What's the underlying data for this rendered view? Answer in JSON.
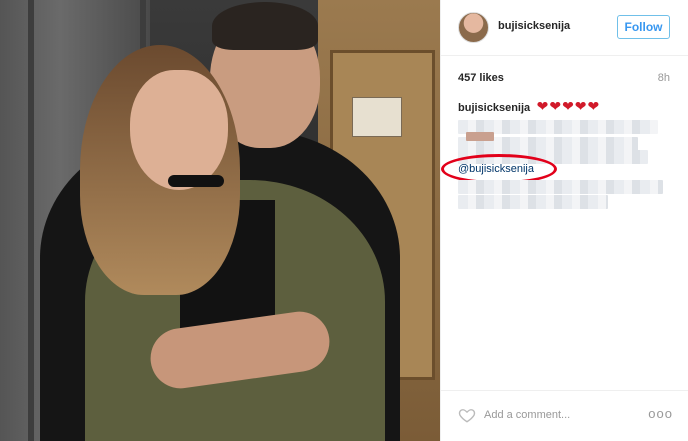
{
  "post": {
    "username": "bujisicksenija",
    "follow_label": "Follow",
    "likes": "457 likes",
    "time_ago": "8h",
    "caption_user": "bujisicksenija",
    "caption_emoji": "❤❤❤❤❤",
    "mention": "@bujisicksenija",
    "comment_placeholder": "Add a comment...",
    "more_label": "ooo"
  },
  "colors": {
    "follow_blue": "#3897f0",
    "mention_link": "#003569",
    "highlight_red": "#e2001a",
    "heart_red": "#d11a2a"
  },
  "icons": {
    "like": "heart-outline-icon",
    "options": "more-options-icon"
  }
}
